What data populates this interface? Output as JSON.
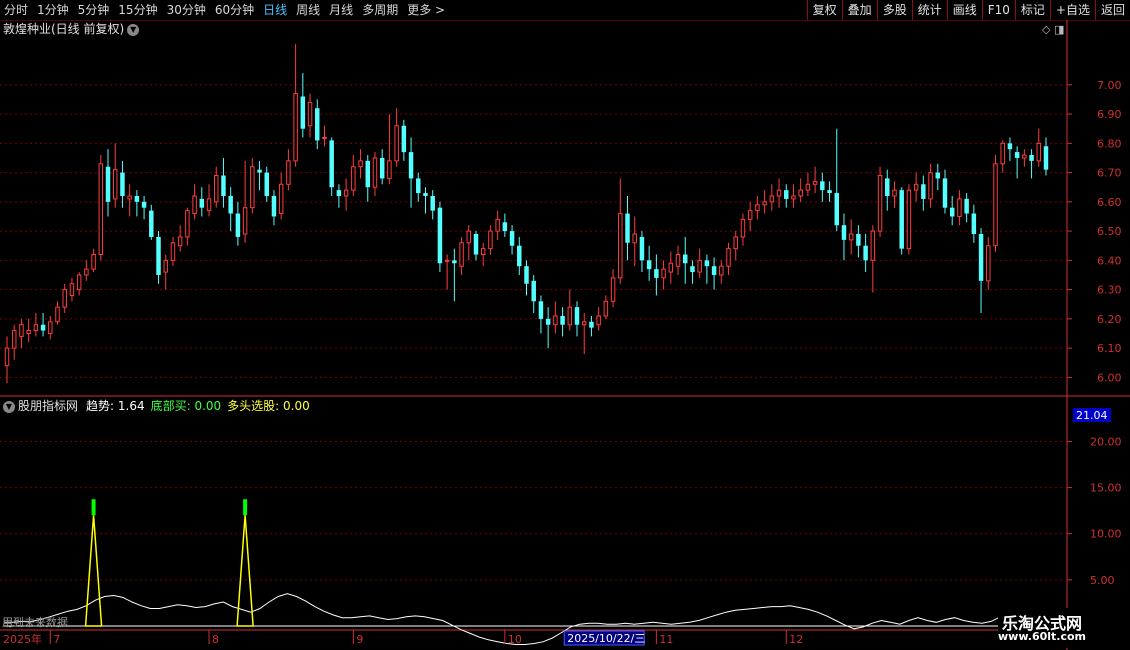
{
  "toolbar": {
    "periods": [
      "分时",
      "1分钟",
      "5分钟",
      "15分钟",
      "30分钟",
      "60分钟",
      "日线",
      "周线",
      "月线",
      "多周期",
      "更多 >"
    ],
    "active_period": "日线",
    "buttons": [
      "复权",
      "叠加",
      "多股",
      "统计",
      "画线",
      "F10",
      "标记",
      "+自选",
      "返回"
    ]
  },
  "stock_title": "敦煌种业(日线 前复权)",
  "indicator": {
    "name": "股朋指标网",
    "trend_label": "趋势: 1.64",
    "bottom_label": "底部买: 0.00",
    "multi_label": "多头选股: 0.00",
    "current_value": "21.04"
  },
  "future_note": "用到未来数据",
  "crosshair_date": "2025/10/22/三",
  "logo": {
    "main": "乐淘公式网",
    "url": "www.60lt.com"
  },
  "colors": {
    "up": "#ff3c3c",
    "down": "#54ffff",
    "grid": "#7a0000",
    "axis": "#d03030",
    "trend": "#ffffff",
    "signal": "#ffff00",
    "signal_top": "#00ff00"
  },
  "chart_data": [
    {
      "type": "candlestick",
      "title": "敦煌种业(日线 前复权)",
      "ylim": [
        5.95,
        7.16
      ],
      "yticks": [
        "7.00",
        "6.90",
        "6.80",
        "6.70",
        "6.60",
        "6.50",
        "6.40",
        "6.30",
        "6.20",
        "6.10",
        "6.00"
      ],
      "ytick_values": [
        7.0,
        6.9,
        6.8,
        6.7,
        6.6,
        6.5,
        6.4,
        6.3,
        6.2,
        6.1,
        6.0
      ],
      "candles": [
        [
          6.04,
          6.1,
          6.14,
          5.98
        ],
        [
          6.1,
          6.16,
          6.18,
          6.06
        ],
        [
          6.14,
          6.18,
          6.2,
          6.1
        ],
        [
          6.15,
          6.16,
          6.2,
          6.12
        ],
        [
          6.16,
          6.18,
          6.22,
          6.14
        ],
        [
          6.18,
          6.16,
          6.22,
          6.14
        ],
        [
          6.15,
          6.19,
          6.21,
          6.13
        ],
        [
          6.19,
          6.24,
          6.26,
          6.18
        ],
        [
          6.24,
          6.3,
          6.32,
          6.22
        ],
        [
          6.28,
          6.32,
          6.34,
          6.26
        ],
        [
          6.3,
          6.35,
          6.36,
          6.28
        ],
        [
          6.35,
          6.37,
          6.4,
          6.33
        ],
        [
          6.37,
          6.42,
          6.44,
          6.36
        ],
        [
          6.42,
          6.73,
          6.76,
          6.4
        ],
        [
          6.72,
          6.6,
          6.78,
          6.55
        ],
        [
          6.61,
          6.71,
          6.8,
          6.58
        ],
        [
          6.7,
          6.62,
          6.74,
          6.58
        ],
        [
          6.61,
          6.62,
          6.66,
          6.55
        ],
        [
          6.62,
          6.6,
          6.64,
          6.55
        ],
        [
          6.6,
          6.58,
          6.62,
          6.54
        ],
        [
          6.57,
          6.48,
          6.59,
          6.47
        ],
        [
          6.48,
          6.35,
          6.5,
          6.32
        ],
        [
          6.36,
          6.4,
          6.42,
          6.3
        ],
        [
          6.4,
          6.46,
          6.48,
          6.38
        ],
        [
          6.45,
          6.48,
          6.52,
          6.43
        ],
        [
          6.48,
          6.57,
          6.58,
          6.45
        ],
        [
          6.56,
          6.62,
          6.66,
          6.54
        ],
        [
          6.61,
          6.58,
          6.65,
          6.55
        ],
        [
          6.57,
          6.61,
          6.66,
          6.55
        ],
        [
          6.6,
          6.69,
          6.72,
          6.58
        ],
        [
          6.69,
          6.62,
          6.75,
          6.58
        ],
        [
          6.62,
          6.56,
          6.65,
          6.5
        ],
        [
          6.56,
          6.48,
          6.6,
          6.45
        ],
        [
          6.49,
          6.58,
          6.74,
          6.46
        ],
        [
          6.58,
          6.72,
          6.75,
          6.56
        ],
        [
          6.71,
          6.7,
          6.74,
          6.64
        ],
        [
          6.7,
          6.62,
          6.72,
          6.6
        ],
        [
          6.62,
          6.55,
          6.64,
          6.52
        ],
        [
          6.56,
          6.66,
          6.7,
          6.54
        ],
        [
          6.66,
          6.74,
          6.78,
          6.64
        ],
        [
          6.74,
          6.97,
          7.14,
          6.72
        ],
        [
          6.96,
          6.85,
          7.04,
          6.82
        ],
        [
          6.86,
          6.94,
          6.97,
          6.82
        ],
        [
          6.92,
          6.81,
          6.95,
          6.78
        ],
        [
          6.82,
          6.82,
          6.86,
          6.79
        ],
        [
          6.81,
          6.65,
          6.82,
          6.62
        ],
        [
          6.64,
          6.62,
          6.66,
          6.58
        ],
        [
          6.62,
          6.64,
          6.68,
          6.57
        ],
        [
          6.64,
          6.72,
          6.76,
          6.62
        ],
        [
          6.72,
          6.74,
          6.78,
          6.68
        ],
        [
          6.74,
          6.65,
          6.76,
          6.6
        ],
        [
          6.65,
          6.75,
          6.77,
          6.62
        ],
        [
          6.75,
          6.68,
          6.78,
          6.66
        ],
        [
          6.68,
          6.74,
          6.9,
          6.66
        ],
        [
          6.74,
          6.86,
          6.92,
          6.72
        ],
        [
          6.86,
          6.77,
          6.88,
          6.74
        ],
        [
          6.77,
          6.68,
          6.82,
          6.58
        ],
        [
          6.68,
          6.63,
          6.7,
          6.6
        ],
        [
          6.63,
          6.62,
          6.65,
          6.56
        ],
        [
          6.62,
          6.57,
          6.64,
          6.54
        ],
        [
          6.58,
          6.39,
          6.6,
          6.36
        ],
        [
          6.4,
          6.4,
          6.42,
          6.3
        ],
        [
          6.4,
          6.39,
          6.44,
          6.26
        ],
        [
          6.38,
          6.46,
          6.48,
          6.35
        ],
        [
          6.46,
          6.5,
          6.52,
          6.4
        ],
        [
          6.49,
          6.42,
          6.5,
          6.4
        ],
        [
          6.42,
          6.44,
          6.46,
          6.38
        ],
        [
          6.44,
          6.5,
          6.52,
          6.42
        ],
        [
          6.5,
          6.54,
          6.57,
          6.47
        ],
        [
          6.53,
          6.5,
          6.56,
          6.48
        ],
        [
          6.5,
          6.45,
          6.52,
          6.42
        ],
        [
          6.45,
          6.38,
          6.48,
          6.35
        ],
        [
          6.38,
          6.32,
          6.4,
          6.28
        ],
        [
          6.33,
          6.26,
          6.35,
          6.22
        ],
        [
          6.26,
          6.2,
          6.28,
          6.15
        ],
        [
          6.2,
          6.18,
          6.24,
          6.1
        ],
        [
          6.18,
          6.21,
          6.26,
          6.15
        ],
        [
          6.21,
          6.18,
          6.24,
          6.14
        ],
        [
          6.18,
          6.24,
          6.3,
          6.16
        ],
        [
          6.24,
          6.18,
          6.26,
          6.14
        ],
        [
          6.18,
          6.19,
          6.22,
          6.08
        ],
        [
          6.19,
          6.17,
          6.21,
          6.14
        ],
        [
          6.18,
          6.21,
          6.24,
          6.16
        ],
        [
          6.21,
          6.26,
          6.28,
          6.2
        ],
        [
          6.26,
          6.34,
          6.37,
          6.24
        ],
        [
          6.34,
          6.56,
          6.68,
          6.32
        ],
        [
          6.56,
          6.46,
          6.62,
          6.4
        ],
        [
          6.46,
          6.49,
          6.55,
          6.38
        ],
        [
          6.48,
          6.4,
          6.5,
          6.36
        ],
        [
          6.4,
          6.37,
          6.45,
          6.33
        ],
        [
          6.37,
          6.34,
          6.42,
          6.28
        ],
        [
          6.34,
          6.37,
          6.4,
          6.3
        ],
        [
          6.36,
          6.39,
          6.43,
          6.32
        ],
        [
          6.38,
          6.42,
          6.45,
          6.35
        ],
        [
          6.42,
          6.39,
          6.48,
          6.32
        ],
        [
          6.38,
          6.36,
          6.4,
          6.32
        ],
        [
          6.36,
          6.4,
          6.44,
          6.34
        ],
        [
          6.4,
          6.38,
          6.42,
          6.32
        ],
        [
          6.38,
          6.35,
          6.41,
          6.3
        ],
        [
          6.35,
          6.38,
          6.4,
          6.32
        ],
        [
          6.38,
          6.44,
          6.46,
          6.35
        ],
        [
          6.44,
          6.48,
          6.5,
          6.4
        ],
        [
          6.48,
          6.54,
          6.56,
          6.45
        ],
        [
          6.54,
          6.57,
          6.6,
          6.5
        ],
        [
          6.57,
          6.59,
          6.62,
          6.54
        ],
        [
          6.59,
          6.6,
          6.64,
          6.56
        ],
        [
          6.6,
          6.62,
          6.66,
          6.57
        ],
        [
          6.62,
          6.64,
          6.68,
          6.58
        ],
        [
          6.64,
          6.61,
          6.66,
          6.58
        ],
        [
          6.61,
          6.62,
          6.66,
          6.58
        ],
        [
          6.62,
          6.64,
          6.68,
          6.6
        ],
        [
          6.64,
          6.66,
          6.7,
          6.62
        ],
        [
          6.66,
          6.67,
          6.72,
          6.63
        ],
        [
          6.67,
          6.64,
          6.7,
          6.6
        ],
        [
          6.64,
          6.63,
          6.67,
          6.6
        ],
        [
          6.63,
          6.52,
          6.85,
          6.5
        ],
        [
          6.52,
          6.47,
          6.56,
          6.4
        ],
        [
          6.47,
          6.49,
          6.54,
          6.42
        ],
        [
          6.49,
          6.45,
          6.52,
          6.41
        ],
        [
          6.45,
          6.4,
          6.49,
          6.36
        ],
        [
          6.4,
          6.5,
          6.52,
          6.29
        ],
        [
          6.5,
          6.69,
          6.72,
          6.48
        ],
        [
          6.68,
          6.62,
          6.71,
          6.57
        ],
        [
          6.62,
          6.64,
          6.67,
          6.58
        ],
        [
          6.64,
          6.44,
          6.65,
          6.42
        ],
        [
          6.44,
          6.64,
          6.66,
          6.42
        ],
        [
          6.64,
          6.66,
          6.7,
          6.6
        ],
        [
          6.66,
          6.61,
          6.69,
          6.57
        ],
        [
          6.61,
          6.7,
          6.73,
          6.58
        ],
        [
          6.7,
          6.68,
          6.73,
          6.64
        ],
        [
          6.68,
          6.58,
          6.71,
          6.56
        ],
        [
          6.58,
          6.55,
          6.62,
          6.52
        ],
        [
          6.55,
          6.61,
          6.64,
          6.52
        ],
        [
          6.61,
          6.56,
          6.63,
          6.53
        ],
        [
          6.56,
          6.49,
          6.59,
          6.46
        ],
        [
          6.49,
          6.33,
          6.51,
          6.22
        ],
        [
          6.33,
          6.45,
          6.48,
          6.3
        ],
        [
          6.45,
          6.73,
          6.76,
          6.43
        ],
        [
          6.73,
          6.8,
          6.81,
          6.7
        ],
        [
          6.8,
          6.78,
          6.82,
          6.74
        ],
        [
          6.77,
          6.75,
          6.79,
          6.68
        ],
        [
          6.75,
          6.76,
          6.78,
          6.72
        ],
        [
          6.76,
          6.74,
          6.78,
          6.68
        ],
        [
          6.74,
          6.8,
          6.85,
          6.72
        ],
        [
          6.79,
          6.71,
          6.82,
          6.69
        ]
      ]
    },
    {
      "type": "line",
      "title": "股朋指标网",
      "ylim": [
        0,
        22
      ],
      "yticks": [
        "20.00",
        "15.00",
        "10.00",
        "5.00"
      ],
      "ytick_values": [
        20,
        15,
        10,
        5
      ],
      "x_labels": [
        "2025年",
        "7",
        "8",
        "9",
        "10",
        "11",
        "12"
      ],
      "x_label_index": [
        0,
        6,
        28,
        48,
        69,
        90,
        108
      ],
      "series": [
        {
          "name": "趋势",
          "values": [
            0.4,
            0.4,
            0.5,
            0.5,
            0.7,
            1.0,
            1.3,
            1.6,
            1.8,
            2.2,
            2.8,
            3.2,
            3.3,
            3.1,
            2.6,
            2.2,
            1.9,
            1.9,
            2.1,
            2.3,
            2.2,
            2.0,
            2.1,
            2.4,
            2.6,
            2.1,
            1.8,
            1.5,
            1.9,
            2.6,
            3.2,
            3.5,
            3.2,
            2.7,
            2.1,
            1.6,
            1.2,
            0.9,
            0.9,
            1.0,
            1.1,
            0.9,
            0.7,
            0.8,
            1.0,
            1.1,
            1.0,
            0.8,
            0.6,
            0.1,
            -0.4,
            -0.8,
            -1.2,
            -1.5,
            -1.7,
            -1.9,
            -2.0,
            -2.0,
            -1.9,
            -1.7,
            -1.3,
            -0.7,
            -0.1,
            0.2,
            0.3,
            0.3,
            0.2,
            0.2,
            0.3,
            0.2,
            0.3,
            0.4,
            0.3,
            0.2,
            0.3,
            0.4,
            0.6,
            0.9,
            1.2,
            1.5,
            1.7,
            1.8,
            1.9,
            2.0,
            2.1,
            2.1,
            2.2,
            2.0,
            1.8,
            1.5,
            1.1,
            0.6,
            0.1,
            -0.3,
            -0.1,
            0.3,
            0.6,
            0.4,
            0.2,
            0.6,
            0.9,
            0.6,
            0.4,
            0.7,
            0.9,
            0.6,
            0.4,
            0.3,
            0.5,
            1.0,
            1.3,
            1.6,
            1.7,
            1.9,
            1.64
          ]
        },
        {
          "name": "底部买",
          "spikes": [
            {
              "index": 12,
              "value": 12.0
            },
            {
              "index": 33,
              "value": 12.0
            }
          ]
        }
      ]
    }
  ]
}
